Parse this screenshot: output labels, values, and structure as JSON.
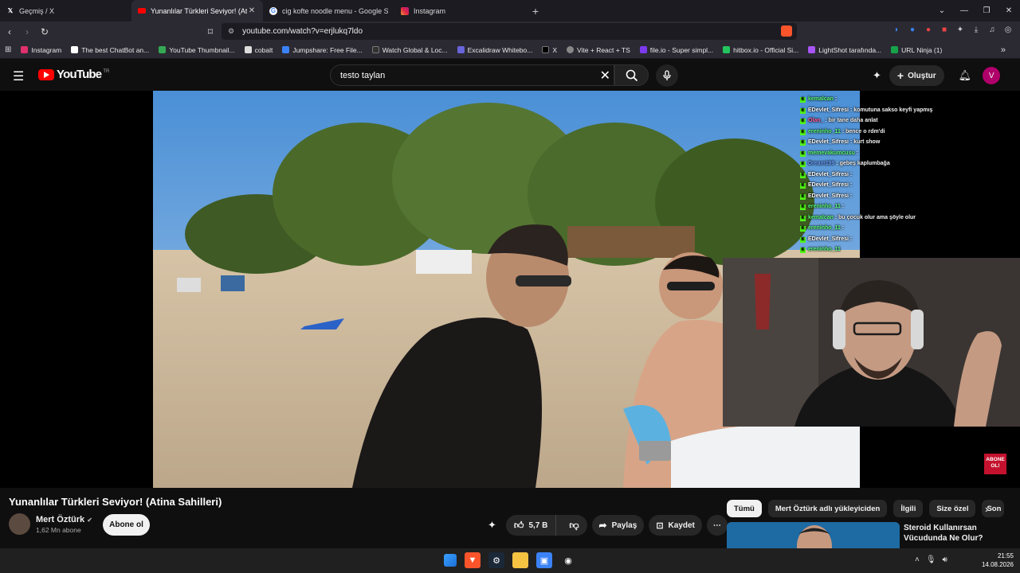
{
  "browser": {
    "tabs": [
      {
        "title": "Geçmiş / X",
        "icon": "x-logo-icon",
        "active": false
      },
      {
        "title": "Yunanlılar Türkleri Seviyor! (Atin",
        "icon": "youtube-icon",
        "active": true
      },
      {
        "title": "cig kofte noodle menu - Google Sear",
        "icon": "google-icon",
        "active": false
      },
      {
        "title": "Instagram",
        "icon": "instagram-icon",
        "active": false
      }
    ],
    "url": "youtube.com/watch?v=erjlukq7ldo",
    "bookmarks": [
      {
        "label": "Instagram",
        "color": "#e1306c"
      },
      {
        "label": "The best ChatBot an...",
        "color": "#ffffff"
      },
      {
        "label": "YouTube Thumbnail...",
        "color": "#34a853"
      },
      {
        "label": "cobalt",
        "color": "#ffffff"
      },
      {
        "label": "Jumpshare: Free File...",
        "color": "#3b82f6"
      },
      {
        "label": "Watch Global & Loc...",
        "color": "#111111"
      },
      {
        "label": "Excalidraw Whitebo...",
        "color": "#6965db"
      },
      {
        "label": "X",
        "color": "#000000"
      },
      {
        "label": "Vite + React + TS",
        "color": "#888888"
      },
      {
        "label": "file.io - Super simpl...",
        "color": "#7c3aed"
      },
      {
        "label": "hitbox.io - Official Si...",
        "color": "#22c55e"
      },
      {
        "label": "LightShot tarafında...",
        "color": "#a855f7"
      },
      {
        "label": "URL Ninja (1)",
        "color": "#16a34a"
      }
    ]
  },
  "youtube": {
    "logo_text": "YouTube",
    "country": "TR",
    "search_query": "testo taylan",
    "create_label": "Oluştur",
    "avatar_letter": "V",
    "accent": "#ff0000"
  },
  "video": {
    "title": "Yunanlılar Türkleri Seviyor! (Atina Sahilleri)",
    "channel": "Mert Öztürk",
    "subscribers": "1,62 Mn abone",
    "subscribe_label": "Abone ol",
    "likes": "5,7 B",
    "share_label": "Paylaş",
    "save_label": "Kaydet",
    "overlay_badge_1": "ABONE",
    "overlay_badge_2": "OL!",
    "chat": [
      {
        "user": "kemalcan",
        "msg": ":"
      },
      {
        "user": "EDevlet_Sifresi",
        "msg": ": komutuna sakso keyfi yapmış"
      },
      {
        "user": "Olan_",
        "msg": ": bir tane daha anlat"
      },
      {
        "user": "ereninho_11",
        "msg": ": bence o rdm'di"
      },
      {
        "user": "EDevlet_Sifresi",
        "msg": ": kurt show"
      },
      {
        "user": "memevakumcusu",
        "msg": ":"
      },
      {
        "user": "Dream199",
        "msg": ": gebeş kaplumbağa"
      },
      {
        "user": "EDevlet_Sifresi",
        "msg": ":"
      },
      {
        "user": "EDevlet_Sifresi",
        "msg": ":"
      },
      {
        "user": "EDevlet_Sifresi",
        "msg": ":"
      },
      {
        "user": "ereninho_11",
        "msg": ":"
      },
      {
        "user": "kemalcan",
        "msg": ": bu çocuk olur ama şöyle olur"
      },
      {
        "user": "ereninho_11",
        "msg": ":"
      },
      {
        "user": "EDevlet_Sifresi",
        "msg": ":"
      },
      {
        "user": "ereninho_11",
        "msg": ""
      }
    ]
  },
  "recommendations": {
    "chips": [
      "Tümü",
      "Mert Öztürk adlı yükleyiciden",
      "İlgili",
      "Size özel",
      "Son"
    ],
    "first_title": "Steroid Kullanırsan Vücudunda Ne Olur?"
  },
  "taskbar": {
    "time": "21:55",
    "date": "14.08.2026"
  }
}
